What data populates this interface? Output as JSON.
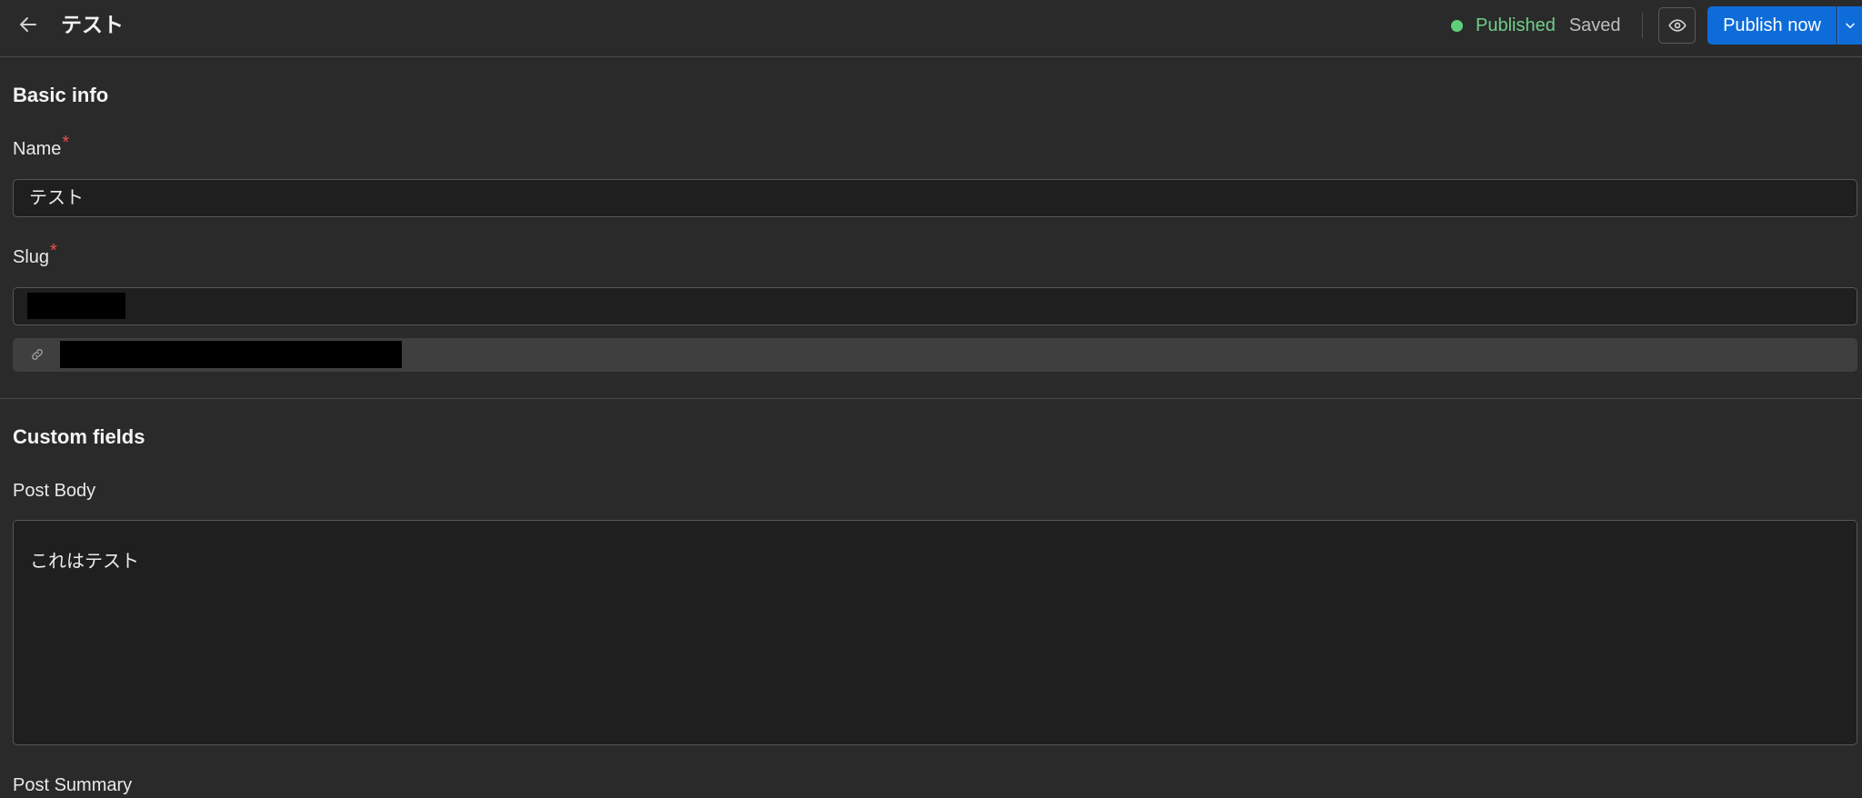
{
  "header": {
    "title": "テスト",
    "status": "Published",
    "save_state": "Saved",
    "publish_label": "Publish now"
  },
  "basic_info": {
    "section_title": "Basic info",
    "name_label": "Name",
    "name_value": "テスト",
    "slug_label": "Slug",
    "required_mark": "*"
  },
  "custom_fields": {
    "section_title": "Custom fields",
    "post_body_label": "Post Body",
    "post_body_value": "これはテスト",
    "post_summary_label": "Post Summary"
  },
  "colors": {
    "published_dot": "#5fd07a",
    "primary_button": "#0d6cd8",
    "required": "#ef4b4b"
  }
}
